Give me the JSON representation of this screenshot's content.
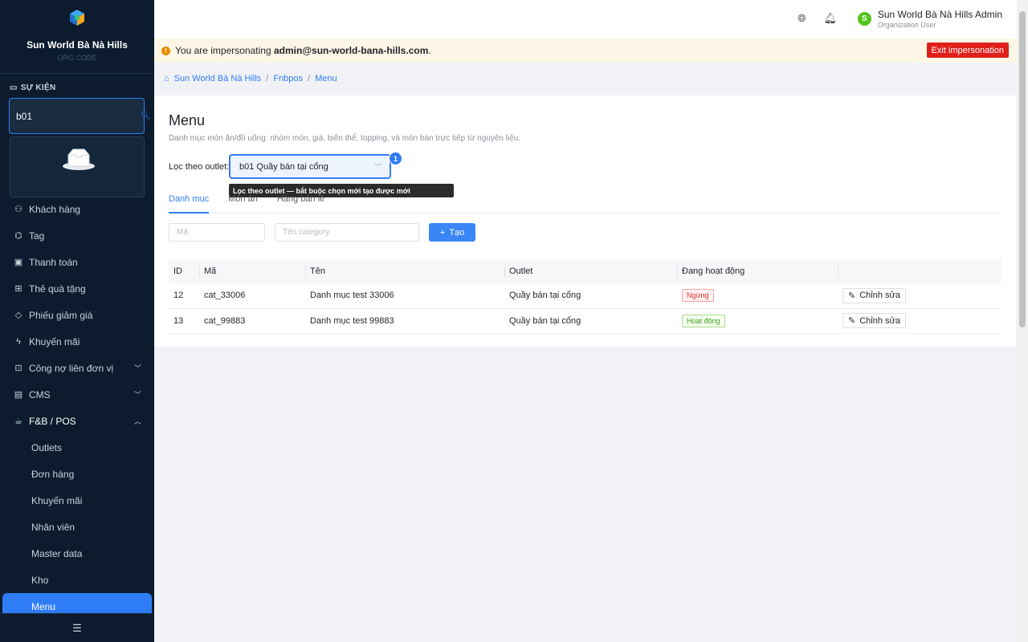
{
  "brand": {
    "name": "Sun World Bà Nà Hills",
    "sub": "ORG CODE"
  },
  "sidebar": {
    "section_label": "SỰ KIỆN",
    "event_search": {
      "value": "b01"
    },
    "items": [
      {
        "label": "Khách hàng",
        "icon": "users-icon"
      },
      {
        "label": "Tag",
        "icon": "tag-icon"
      },
      {
        "label": "Thanh toán",
        "icon": "payment-icon"
      },
      {
        "label": "Thẻ quà tặng",
        "icon": "gift-icon"
      },
      {
        "label": "Phiếu giảm giá",
        "icon": "voucher-icon"
      },
      {
        "label": "Khuyến mãi",
        "icon": "lightning-icon"
      },
      {
        "label": "Công nợ liên đơn vị",
        "icon": "debt-icon"
      },
      {
        "label": "CMS",
        "icon": "cms-icon"
      },
      {
        "label": "F&B / POS",
        "icon": "pos-icon"
      }
    ],
    "sub_items": [
      "Outlets",
      "Đơn hàng",
      "Khuyến mãi",
      "Nhân viên",
      "Master data",
      "Kho",
      "Menu"
    ]
  },
  "topbar": {
    "user_name": "Sun World Bà Nà Hills Admin",
    "user_role": "Organization User",
    "avatar_letter": "S"
  },
  "banner": {
    "prefix": "You are impersonating ",
    "email": "admin@sun-world-bana-hills.com",
    "suffix": ".",
    "exit_label": "Exit impersonation"
  },
  "breadcrumb": [
    "Sun World Bà Nà Hills",
    "Fnbpos",
    "Menu"
  ],
  "page": {
    "title": "Menu",
    "description": "Danh mục món ăn/đồ uống: nhóm món, giá, biến thể, topping, và món bán trực tiếp từ nguyên liệu.",
    "filter_label": "Lọc theo outlet:",
    "filter_value": "b01 Quầy bán tại cổng",
    "badge": "1",
    "tooltip": "Lọc theo outlet — bắt buộc chọn mới tạo được mới",
    "tabs": [
      "Danh mục",
      "Món ăn",
      "Hàng bán lẻ"
    ],
    "code_placeholder": "Mã",
    "name_placeholder": "Tên category",
    "create_label": "Tạo"
  },
  "table": {
    "headers": [
      "ID",
      "Mã",
      "Tên",
      "Outlet",
      "Đang hoạt động",
      ""
    ],
    "rows": [
      {
        "id": "12",
        "code": "cat_33006",
        "name": "Danh mục test 33006",
        "outlet": "Quầy bán tại cổng",
        "status": "Ngừng",
        "action": "Chỉnh sửa"
      },
      {
        "id": "13",
        "code": "cat_99883",
        "name": "Danh mục test 99883",
        "outlet": "Quầy bán tại cổng",
        "status": "Hoạt động",
        "action": "Chỉnh sửa"
      }
    ]
  },
  "colors": {
    "accent": "#2f7df6",
    "sidebar_bg": "#0c1c2e",
    "danger": "#e0201b"
  }
}
